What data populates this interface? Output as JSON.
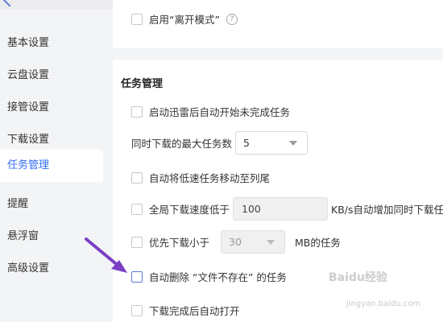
{
  "sidebar": {
    "items": [
      {
        "label": "基本设置"
      },
      {
        "label": "云盘设置"
      },
      {
        "label": "接管设置"
      },
      {
        "label": "下载设置"
      },
      {
        "label": "任务管理"
      },
      {
        "label": "提醒"
      },
      {
        "label": "悬浮窗"
      },
      {
        "label": "高级设置"
      }
    ],
    "active_index": 4
  },
  "card_top": {
    "away_mode_label": "启用“离开模式”",
    "help_glyph": "?"
  },
  "task": {
    "title": "任务管理",
    "auto_start_label": "启动迅雷后自动开始未完成任务",
    "max_tasks_label": "同时下载的最大任务数",
    "max_tasks_value": "5",
    "move_slow_label": "自动将低速任务移动至列尾",
    "speed_label": "全局下载速度低于",
    "speed_value": "100",
    "speed_suffix": "KB/s自动增加同时下载任务",
    "small_first_label": "优先下载小于",
    "small_first_value": "30",
    "small_first_suffix": "MB的任务",
    "auto_delete_label": "自动删除 “文件不存在” 的任务",
    "open_after_label": "下载完成后自动打开"
  },
  "watermark": {
    "logo_text": "Baidu经验",
    "url": "jingyan.baidu.com"
  },
  "colors": {
    "accent": "#2f6cf5",
    "arrow": "#7b3fc4"
  }
}
